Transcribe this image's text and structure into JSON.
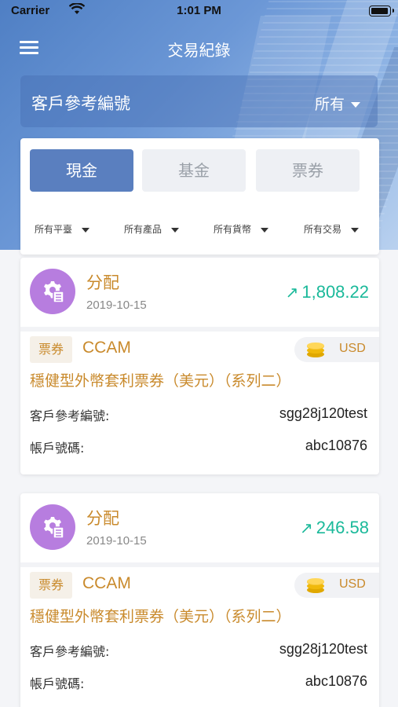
{
  "status_bar": {
    "carrier": "Carrier",
    "time": "1:01 PM"
  },
  "header": {
    "title": "交易紀錄"
  },
  "search": {
    "label": "客戶參考編號",
    "selected": "所有"
  },
  "tabs": [
    {
      "label": "現金",
      "active": true
    },
    {
      "label": "基金",
      "active": false
    },
    {
      "label": "票券",
      "active": false
    }
  ],
  "filters": [
    {
      "label": "所有平臺"
    },
    {
      "label": "所有產品"
    },
    {
      "label": "所有貨幣"
    },
    {
      "label": "所有交易"
    }
  ],
  "transactions": [
    {
      "type": "分配",
      "date": "2019-10-15",
      "amount": "1,808.22",
      "badge": "票券",
      "code": "CCAM",
      "currency": "USD",
      "product_name": "穩健型外幣套利票券（美元）（系列二）",
      "ref_label": "客戶參考編號:",
      "ref_value": "sgg28j120test",
      "account_label": "帳戶號碼:",
      "account_value": "abc10876"
    },
    {
      "type": "分配",
      "date": "2019-10-15",
      "amount": "246.58",
      "badge": "票券",
      "code": "CCAM",
      "currency": "USD",
      "product_name": "穩健型外幣套利票券（美元）（系列二）",
      "ref_label": "客戶參考編號:",
      "ref_value": "sgg28j120test",
      "account_label": "帳戶號碼:",
      "account_value": "abc10876"
    }
  ],
  "colors": {
    "accent_gold": "#c98a2c",
    "positive_green": "#1ab99a",
    "tab_active": "#5a7fbf",
    "avatar_purple": "#b77ddf"
  },
  "icons": {
    "menu": "menu-icon",
    "wifi": "wifi-icon",
    "battery": "battery-icon",
    "avatar": "gear-document-icon",
    "trend": "trend-up-arrow-icon",
    "coin": "coins-icon"
  }
}
